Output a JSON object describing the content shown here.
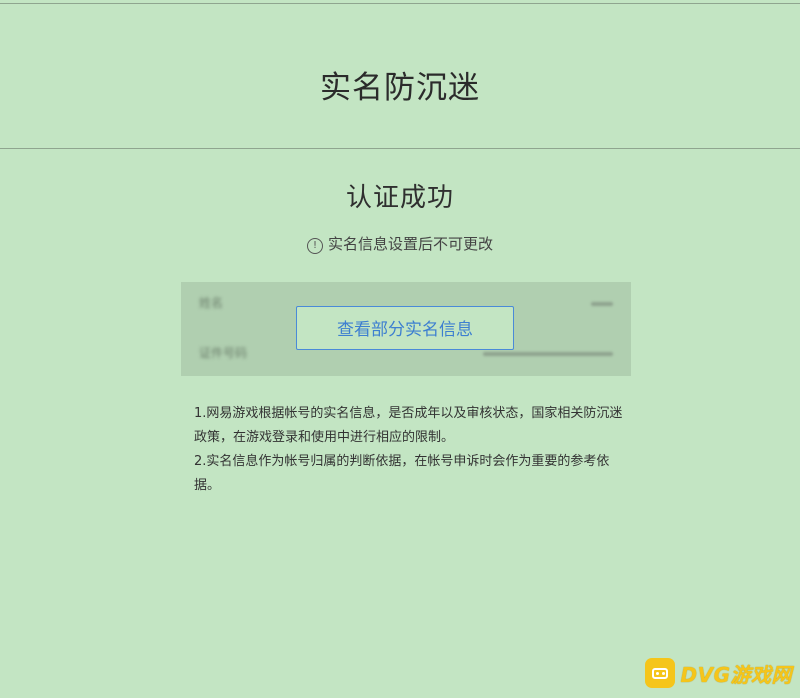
{
  "header": {
    "title": "实名防沉迷"
  },
  "status": {
    "title": "认证成功",
    "notice_icon": "info-icon",
    "notice_icon_glyph": "!",
    "notice_text": "实名信息设置后不可更改"
  },
  "info_card": {
    "rows": [
      {
        "label": "姓名"
      },
      {
        "label": "证件号码"
      }
    ],
    "view_button_label": "查看部分实名信息"
  },
  "notes": [
    "1.网易游戏根据帐号的实名信息，是否成年以及审核状态，国家相关防沉迷政策，在游戏登录和使用中进行相应的限制。",
    "2.实名信息作为帐号归属的判断依据，在帐号申诉时会作为重要的参考依据。"
  ],
  "watermark": {
    "icon": "gamepad-icon",
    "text": "DVG游戏网"
  },
  "colors": {
    "background": "#c3e5c3",
    "card": "#b0cfb0",
    "accent": "#3d7fd0",
    "watermark": "#f5c51a"
  }
}
